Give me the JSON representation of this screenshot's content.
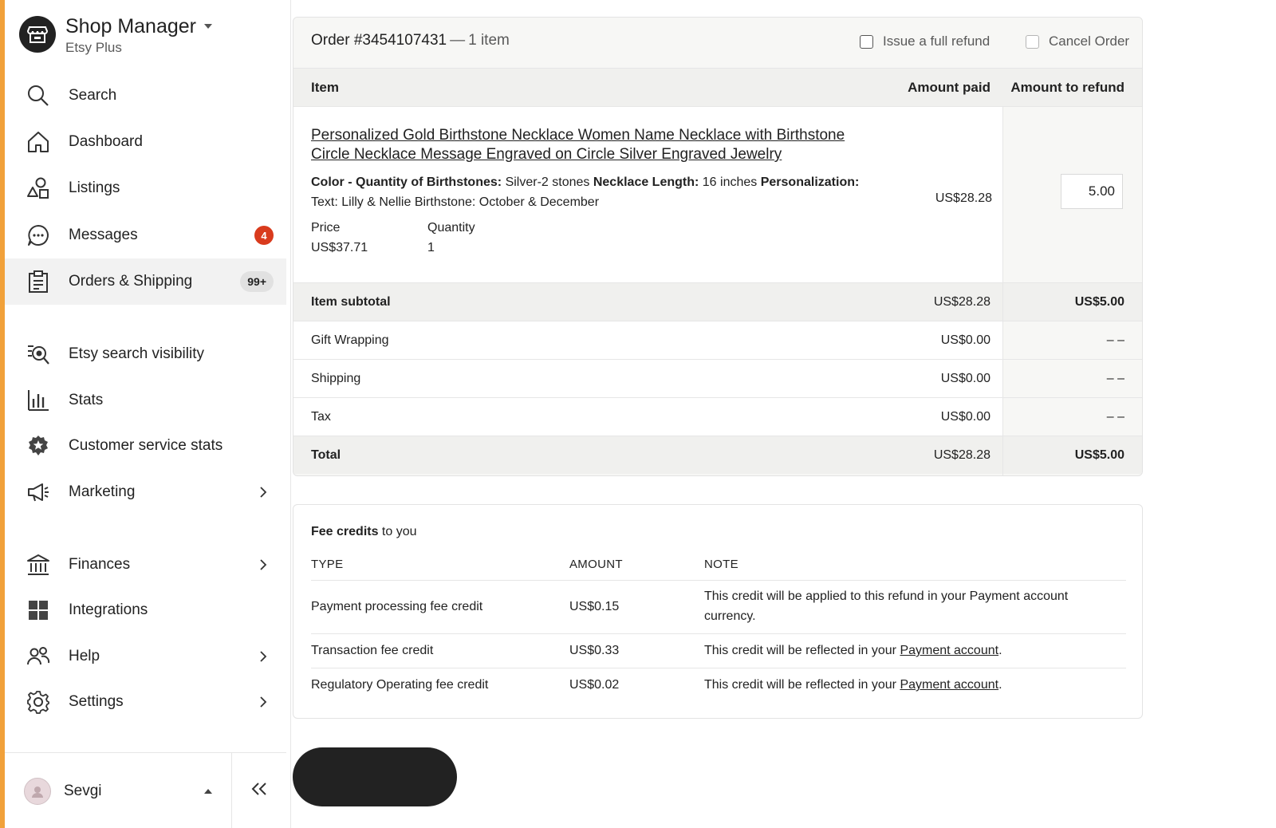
{
  "sidebar": {
    "shop_title": "Shop Manager",
    "shop_subtitle": "Etsy Plus",
    "items": [
      {
        "label": "Search",
        "icon": "search-icon"
      },
      {
        "label": "Dashboard",
        "icon": "home-icon"
      },
      {
        "label": "Listings",
        "icon": "shapes-icon"
      },
      {
        "label": "Messages",
        "icon": "chat-icon",
        "badge": "4"
      },
      {
        "label": "Orders & Shipping",
        "icon": "clipboard-icon",
        "badge": "99+",
        "active": true
      },
      {
        "label": "Etsy search visibility",
        "icon": "search-visibility-icon"
      },
      {
        "label": "Stats",
        "icon": "bar-chart-icon"
      },
      {
        "label": "Customer service stats",
        "icon": "star-badge-icon"
      },
      {
        "label": "Marketing",
        "icon": "megaphone-icon",
        "has_submenu": true
      },
      {
        "label": "Finances",
        "icon": "bank-icon",
        "has_submenu": true
      },
      {
        "label": "Integrations",
        "icon": "grid-icon"
      },
      {
        "label": "Help",
        "icon": "people-icon",
        "has_submenu": true
      },
      {
        "label": "Settings",
        "icon": "gear-icon",
        "has_submenu": true
      }
    ],
    "user": {
      "name": "Sevgi"
    }
  },
  "order": {
    "title": "Order #3454107431",
    "separator": "—",
    "item_count": "1 item",
    "full_refund_label": "Issue a full refund",
    "cancel_label": "Cancel Order",
    "columns": {
      "item": "Item",
      "amount_paid": "Amount paid",
      "amount_to_refund": "Amount to refund"
    },
    "item": {
      "title": "Personalized Gold Birthstone Necklace Women Name Necklace with Birthstone Circle Necklace Message Engraved on Circle Silver Engraved Jewelry",
      "var1_label": "Color - Quantity of Birthstones:",
      "var1_value": "Silver-2 stones",
      "var2_label": "Necklace Length:",
      "var2_value": "16 inches",
      "var3_label": "Personalization:",
      "var3_value": "Text: Lilly & Nellie Birthstone: October & December",
      "price_label": "Price",
      "price_value": "US$37.71",
      "quantity_label": "Quantity",
      "quantity_value": "1",
      "amount_paid": "US$28.28",
      "refund_value": "5.00"
    },
    "summary": [
      {
        "label": "Item subtotal",
        "paid": "US$28.28",
        "refund": "US$5.00"
      },
      {
        "label": "Gift Wrapping",
        "paid": "US$0.00",
        "refund": "– –"
      },
      {
        "label": "Shipping",
        "paid": "US$0.00",
        "refund": "– –"
      },
      {
        "label": "Tax",
        "paid": "US$0.00",
        "refund": "– –"
      },
      {
        "label": "Total",
        "paid": "US$28.28",
        "refund": "US$5.00"
      }
    ]
  },
  "fees": {
    "title_bold": "Fee credits",
    "title_rest": " to you",
    "columns": {
      "type": "TYPE",
      "amount": "AMOUNT",
      "note": "NOTE"
    },
    "rows": [
      {
        "type": "Payment processing fee credit",
        "amount": "US$0.15",
        "note": "This credit will be applied to this refund in your Payment account currency."
      },
      {
        "type": "Transaction fee credit",
        "amount": "US$0.33",
        "note_pre": "This credit will be reflected in your ",
        "note_link": "Payment account",
        "note_post": "."
      },
      {
        "type": "Regulatory Operating fee credit",
        "amount": "US$0.02",
        "note_pre": "This credit will be reflected in your ",
        "note_link": "Payment account",
        "note_post": "."
      }
    ]
  },
  "colors": {
    "accent": "#f1a13a",
    "badge_red": "#d93b1d",
    "dark": "#222222"
  }
}
